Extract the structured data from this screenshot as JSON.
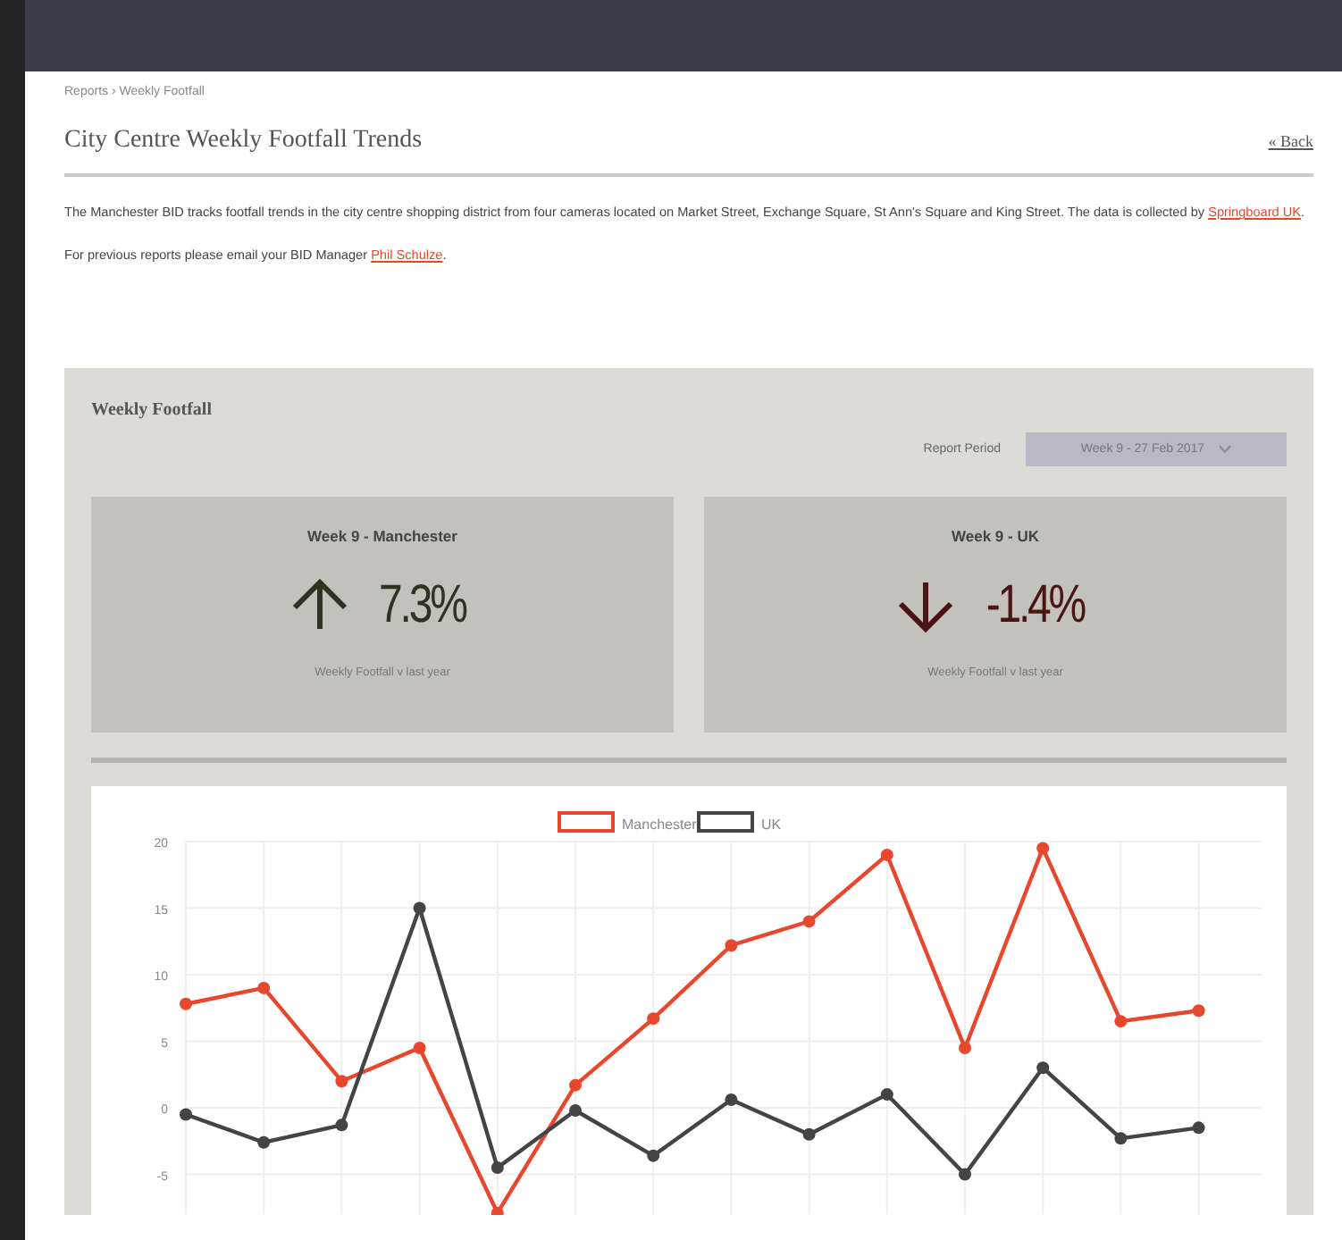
{
  "breadcrumb": "Reports › Weekly Footfall",
  "title": "City Centre Weekly Footfall Trends",
  "back_link": "« Back",
  "intro": {
    "text": "The Manchester BID tracks footfall trends in the city centre shopping district from four cameras located on Market Street, Exchange Square, St Ann's Square and King Street. The data is collected by ",
    "link": "Springboard UK",
    "end": "."
  },
  "contact": {
    "text": "For previous reports please email your BID Manager ",
    "link": "Phil Schulze",
    "end": "."
  },
  "panel": {
    "title": "Weekly Footfall",
    "period_label": "Report Period",
    "period_value": "Week 9 - 27 Feb 2017",
    "cards": [
      {
        "heading": "Week 9 - Manchester",
        "kind": "up",
        "value": "7.3%",
        "caption": "Weekly Footfall v last year"
      },
      {
        "heading": "Week 9 - UK",
        "kind": "down",
        "value": "-1.4%",
        "caption": "Weekly Footfall v last year"
      }
    ],
    "chart_data": {
      "type": "line",
      "yticks": [
        20,
        15,
        10,
        5,
        0,
        -5
      ],
      "ylim": [
        -8,
        20
      ],
      "grid": true,
      "legend": true,
      "series": [
        {
          "name": "Manchester",
          "color": "#e8472e",
          "marker": true,
          "values": [
            7.8,
            9,
            2,
            4.5,
            -7.9,
            1.7,
            6.7,
            12.2,
            14,
            19,
            4.5,
            19.5,
            6.5,
            7.3
          ]
        },
        {
          "name": "UK",
          "color": "#444444",
          "marker": true,
          "values": [
            -0.5,
            -2.6,
            -1.3,
            15,
            -4.5,
            -0.2,
            -3.6,
            0.6,
            -2,
            1,
            -5,
            3,
            -2.3,
            -1.5
          ]
        }
      ]
    }
  }
}
